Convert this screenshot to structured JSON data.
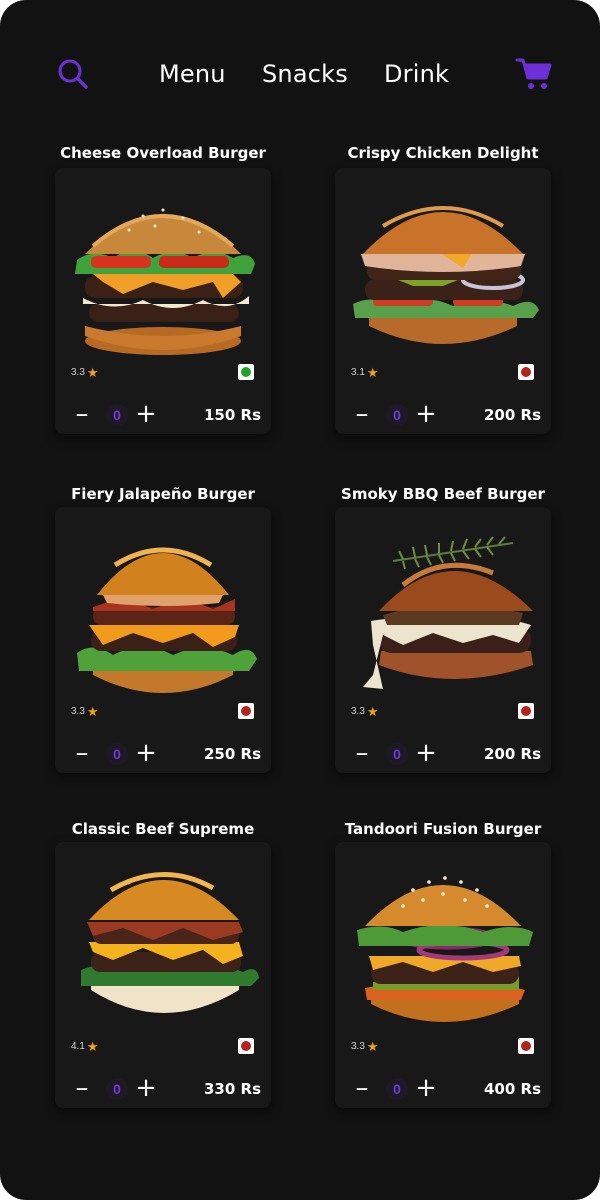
{
  "colors": {
    "background": "#121212",
    "card": "#181818",
    "accent": "#6d2fd6",
    "star": "#f0a21a",
    "veg": "#1fa52a",
    "nonveg": "#b42318"
  },
  "nav": {
    "search_icon": "search-icon",
    "cart_icon": "cart-icon",
    "links": [
      "Menu",
      "Snacks",
      "Drink"
    ]
  },
  "products": [
    {
      "name": "Cheese Overload Burger",
      "rating": "3.3",
      "veg": true,
      "quantity": "0",
      "price": "150 Rs"
    },
    {
      "name": "Crispy Chicken Delight",
      "rating": "3.1",
      "veg": false,
      "quantity": "0",
      "price": "200 Rs"
    },
    {
      "name": "Fiery Jalapeño Burger",
      "rating": "3.3",
      "veg": false,
      "quantity": "0",
      "price": "250 Rs"
    },
    {
      "name": "Smoky BBQ Beef Burger",
      "rating": "3.3",
      "veg": false,
      "quantity": "0",
      "price": "200 Rs"
    },
    {
      "name": "Classic Beef Supreme",
      "rating": "4.1",
      "veg": false,
      "quantity": "0",
      "price": "330 Rs"
    },
    {
      "name": "Tandoori Fusion Burger",
      "rating": "3.3",
      "veg": false,
      "quantity": "0",
      "price": "400 Rs"
    }
  ]
}
